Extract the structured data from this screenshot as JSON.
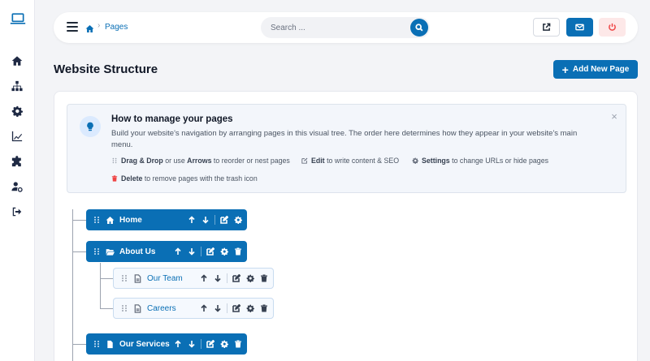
{
  "sidebar": {
    "items": [
      {
        "name": "laptop-logo-icon"
      },
      {
        "name": "home-icon"
      },
      {
        "name": "sitemap-icon"
      },
      {
        "name": "gear-icon"
      },
      {
        "name": "chart-line-icon"
      },
      {
        "name": "puzzle-icon"
      },
      {
        "name": "user-cog-icon"
      },
      {
        "name": "sign-out-icon"
      }
    ]
  },
  "topbar": {
    "breadcrumb": {
      "current": "Pages",
      "separator": "›"
    },
    "search": {
      "placeholder": "Search ..."
    }
  },
  "header": {
    "title": "Website Structure",
    "add_button": "Add New Page"
  },
  "info": {
    "title": "How to manage your pages",
    "description": "Build your website's navigation by arranging pages in this visual tree. The order here determines how they appear in your website's main menu.",
    "tips": [
      {
        "bold": "Drag & Drop",
        "text1": " or use ",
        "bold2": "Arrows",
        "text2": " to reorder or nest pages"
      },
      {
        "bold": "Edit",
        "text1": " to write content & SEO"
      },
      {
        "bold": "Settings",
        "text1": " to change URLs or hide pages"
      },
      {
        "bold": "Delete",
        "text1": " to remove pages with the trash icon"
      }
    ],
    "close": "×"
  },
  "tree": {
    "nodes": [
      {
        "label": "Home",
        "level": 0,
        "icon": "home-icon",
        "deletable": false
      },
      {
        "label": "About Us",
        "level": 0,
        "icon": "folder-open-icon",
        "deletable": true
      },
      {
        "label": "Our Team",
        "level": 1,
        "icon": "file-icon",
        "deletable": true
      },
      {
        "label": "Careers",
        "level": 1,
        "icon": "file-icon",
        "deletable": true
      },
      {
        "label": "Our Services",
        "level": 0,
        "icon": "file-icon",
        "deletable": true
      }
    ]
  },
  "colors": {
    "accent": "#0a6fb5",
    "danger": "#ef4444",
    "background": "#f3f4f7"
  }
}
